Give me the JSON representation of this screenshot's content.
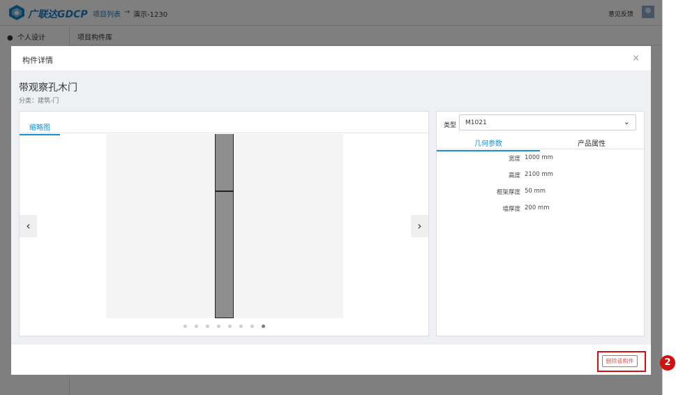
{
  "app": {
    "logo_text": "广联达GDCP",
    "breadcrumb": {
      "project_list": "项目列表",
      "arrow": "→",
      "project": "演示-1230"
    },
    "feedback": "意见反馈"
  },
  "sidebar": {
    "items": [
      {
        "label": "个人设计"
      }
    ]
  },
  "subheader": {
    "title": "项目构件库"
  },
  "modal": {
    "title": "构件详情",
    "close_symbol": "×",
    "component_name": "带观察孔木门",
    "category": "分类：建筑-门",
    "preview_tab": "缩略图",
    "prev_symbol": "‹",
    "next_symbol": "›",
    "slides": {
      "count": 8,
      "active": 7
    },
    "type_label": "类型",
    "type_value": "M1021",
    "tabs": {
      "geometry": "几何参数",
      "product": "产品属性"
    },
    "params": [
      {
        "key": "宽度",
        "value": "1000 mm"
      },
      {
        "key": "高度",
        "value": "2100 mm"
      },
      {
        "key": "框架厚度",
        "value": "50 mm"
      },
      {
        "key": "墙厚度",
        "value": "200 mm"
      }
    ],
    "delete_label": "删除该构件"
  },
  "annotation": {
    "step": "2"
  },
  "colors": {
    "accent": "#1a8fd0",
    "danger": "#e25a5a",
    "highlight": "#d31010"
  }
}
